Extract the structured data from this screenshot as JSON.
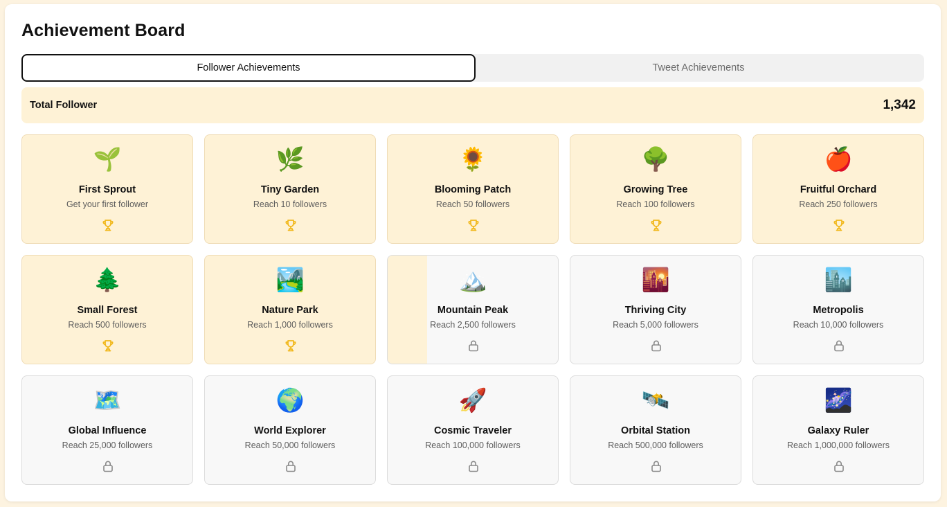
{
  "title": "Achievement Board",
  "tabs": [
    {
      "label": "Follower Achievements",
      "active": true
    },
    {
      "label": "Tweet Achievements",
      "active": false
    }
  ],
  "total": {
    "label": "Total Follower",
    "value": "1,342"
  },
  "colors": {
    "earned_bg": "#fef2d6",
    "locked_bg": "#f8f8f8",
    "trophy": "#f1b81c",
    "lock": "#8a8a8a"
  },
  "achievements": [
    {
      "icon": "🌱",
      "icon_name": "seedling-icon",
      "name": "First Sprout",
      "desc": "Get your first follower",
      "status": "earned",
      "progress": 1
    },
    {
      "icon": "🌿",
      "icon_name": "herb-icon",
      "name": "Tiny Garden",
      "desc": "Reach 10 followers",
      "status": "earned",
      "progress": 1
    },
    {
      "icon": "🌻",
      "icon_name": "sunflower-icon",
      "name": "Blooming Patch",
      "desc": "Reach 50 followers",
      "status": "earned",
      "progress": 1
    },
    {
      "icon": "🌳",
      "icon_name": "tree-icon",
      "name": "Growing Tree",
      "desc": "Reach 100 followers",
      "status": "earned",
      "progress": 1
    },
    {
      "icon": "🍎",
      "icon_name": "apple-icon",
      "name": "Fruitful Orchard",
      "desc": "Reach 250 followers",
      "status": "earned",
      "progress": 1
    },
    {
      "icon": "🌲",
      "icon_name": "evergreen-tree-icon",
      "name": "Small Forest",
      "desc": "Reach 500 followers",
      "status": "earned",
      "progress": 1
    },
    {
      "icon": "🏞️",
      "icon_name": "national-park-icon",
      "name": "Nature Park",
      "desc": "Reach 1,000 followers",
      "status": "earned",
      "progress": 1
    },
    {
      "icon": "🏔️",
      "icon_name": "mountain-icon",
      "name": "Mountain Peak",
      "desc": "Reach 2,500 followers",
      "status": "locked",
      "progress": 0.23
    },
    {
      "icon": "🌇",
      "icon_name": "city-sunset-icon",
      "name": "Thriving City",
      "desc": "Reach 5,000 followers",
      "status": "locked",
      "progress": 0
    },
    {
      "icon": "🏙️",
      "icon_name": "cityscape-icon",
      "name": "Metropolis",
      "desc": "Reach 10,000 followers",
      "status": "locked",
      "progress": 0
    },
    {
      "icon": "🗺️",
      "icon_name": "world-map-icon",
      "name": "Global Influence",
      "desc": "Reach 25,000 followers",
      "status": "locked",
      "progress": 0
    },
    {
      "icon": "🌍",
      "icon_name": "globe-icon",
      "name": "World Explorer",
      "desc": "Reach 50,000 followers",
      "status": "locked",
      "progress": 0
    },
    {
      "icon": "🚀",
      "icon_name": "rocket-icon",
      "name": "Cosmic Traveler",
      "desc": "Reach 100,000 followers",
      "status": "locked",
      "progress": 0
    },
    {
      "icon": "🛰️",
      "icon_name": "satellite-icon",
      "name": "Orbital Station",
      "desc": "Reach 500,000 followers",
      "status": "locked",
      "progress": 0
    },
    {
      "icon": "🌌",
      "icon_name": "milky-way-icon",
      "name": "Galaxy Ruler",
      "desc": "Reach 1,000,000 followers",
      "status": "locked",
      "progress": 0
    }
  ]
}
